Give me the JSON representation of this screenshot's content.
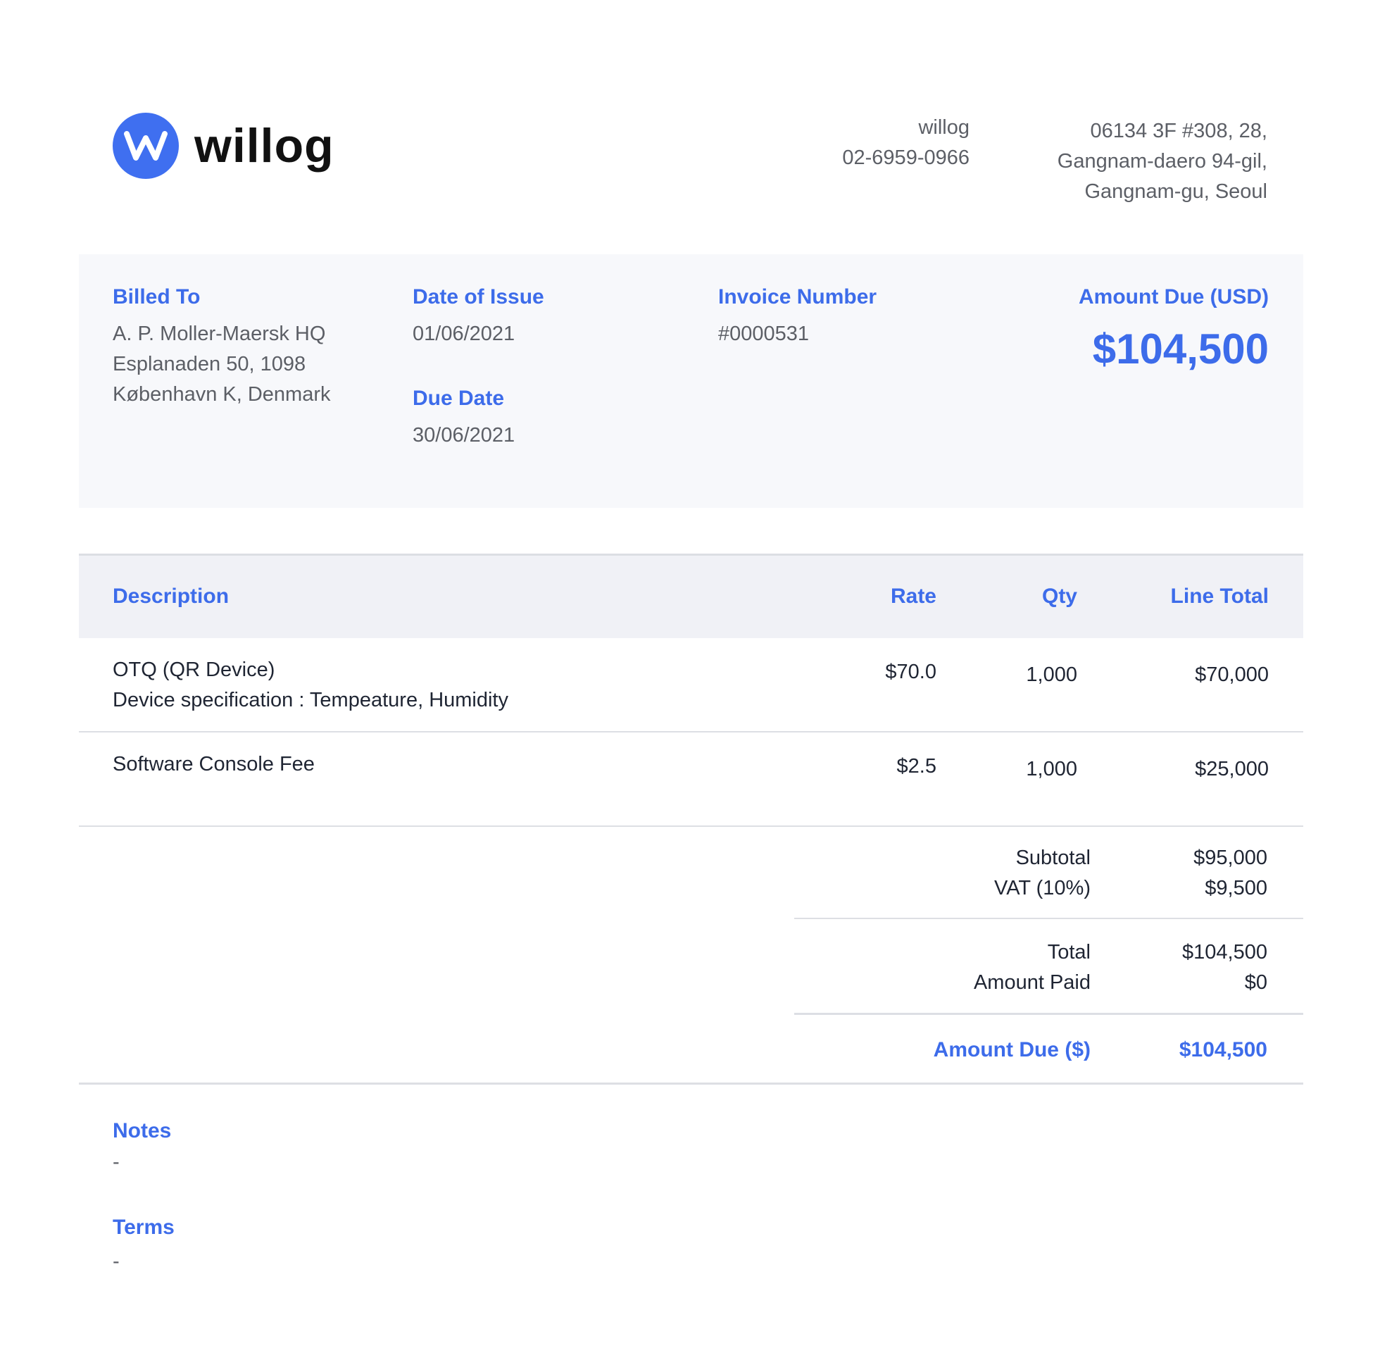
{
  "brand": {
    "name": "willog",
    "logo_letter": "W",
    "accent": "#3d6cea"
  },
  "company": {
    "name": "willog",
    "phone": "02-6959-0966",
    "address_lines": [
      "06134 3F #308, 28,",
      "Gangnam-daero 94-gil,",
      "Gangnam-gu, Seoul"
    ]
  },
  "summary": {
    "billed_to_label": "Billed To",
    "billed_to_lines": [
      "A. P. Moller-Maersk HQ",
      "Esplanaden 50, 1098",
      "København K, Denmark"
    ],
    "issue_label": "Date of Issue",
    "issue_date": "01/06/2021",
    "due_label": "Due Date",
    "due_date": "30/06/2021",
    "invoice_label": "Invoice Number",
    "invoice_number": "#0000531",
    "amount_label": "Amount Due (USD)",
    "amount_value": "$104,500"
  },
  "table": {
    "headers": {
      "description": "Description",
      "rate": "Rate",
      "qty": "Qty",
      "line_total": "Line Total"
    },
    "rows": [
      {
        "desc_line1": "OTQ (QR Device)",
        "desc_line2": "Device specification : Tempeature, Humidity",
        "rate": "$70.0",
        "qty": "1,000",
        "total": "$70,000"
      },
      {
        "desc_line1": "Software Console Fee",
        "desc_line2": "",
        "rate": "$2.5",
        "qty": "1,000",
        "total": "$25,000"
      }
    ]
  },
  "totals": {
    "subtotal_label": "Subtotal",
    "subtotal": "$95,000",
    "vat_label": "VAT (10%)",
    "vat": "$9,500",
    "total_label": "Total",
    "total": "$104,500",
    "paid_label": "Amount Paid",
    "paid": "$0",
    "due_label": "Amount Due ($)",
    "due": "$104,500"
  },
  "notes": {
    "notes_label": "Notes",
    "notes_value": "-",
    "terms_label": "Terms",
    "terms_value": "-"
  }
}
